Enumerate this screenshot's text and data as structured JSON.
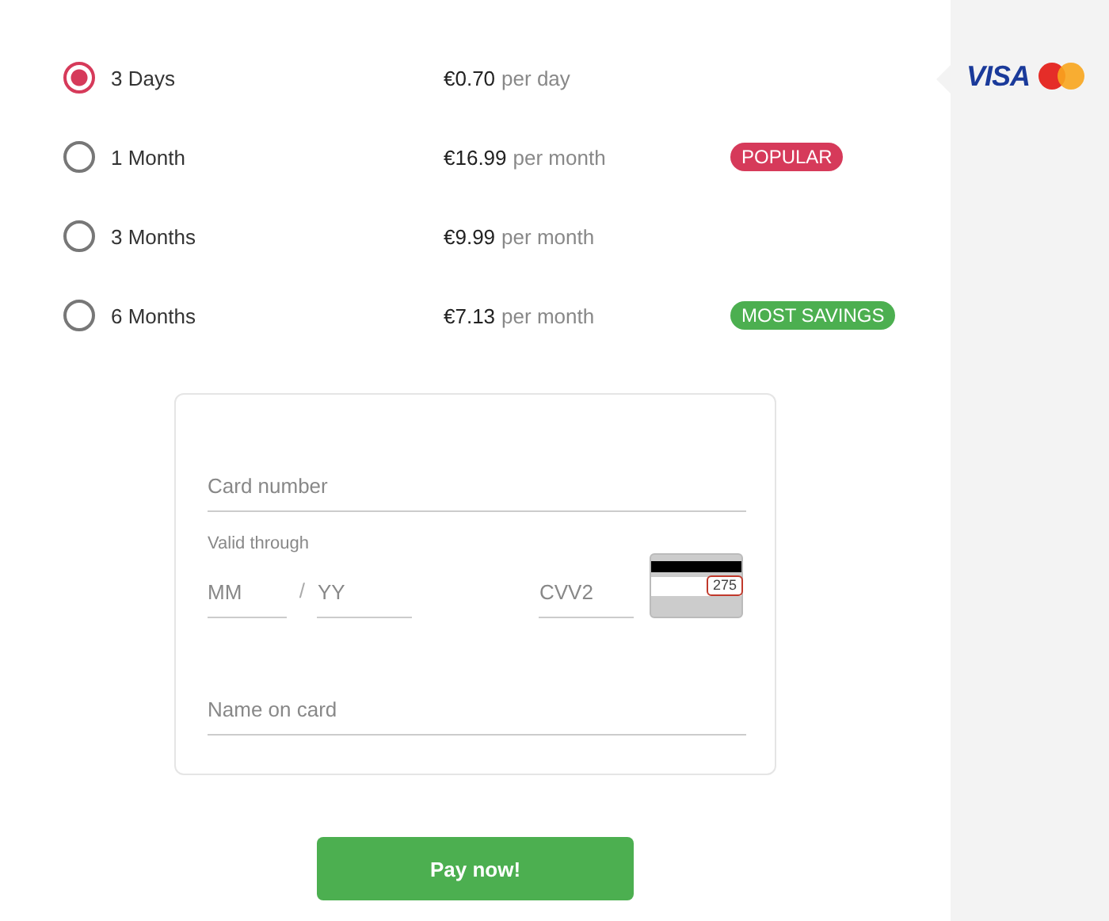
{
  "plans": [
    {
      "label": "3 Days",
      "price": "€0.70",
      "period": "per day",
      "selected": true
    },
    {
      "label": "1 Month",
      "price": "€16.99",
      "period": "per month",
      "selected": false,
      "badge": {
        "text": "POPULAR",
        "color": "#d63a5a"
      }
    },
    {
      "label": "3 Months",
      "price": "€9.99",
      "period": "per month",
      "selected": false
    },
    {
      "label": "6 Months",
      "price": "€7.13",
      "period": "per month",
      "selected": false,
      "badge": {
        "text": "MOST SAVINGS",
        "color": "#4caf50"
      }
    }
  ],
  "payment_brands": {
    "visa": "VISA"
  },
  "card_form": {
    "card_number": {
      "placeholder": "Card number"
    },
    "valid_through": "Valid through",
    "month": {
      "placeholder": "MM"
    },
    "separator": "/",
    "year": {
      "placeholder": "YY"
    },
    "cvv": {
      "placeholder": "CVV2"
    },
    "cvv_example": "275",
    "name": {
      "placeholder": "Name on card"
    }
  },
  "pay_button": "Pay now!"
}
